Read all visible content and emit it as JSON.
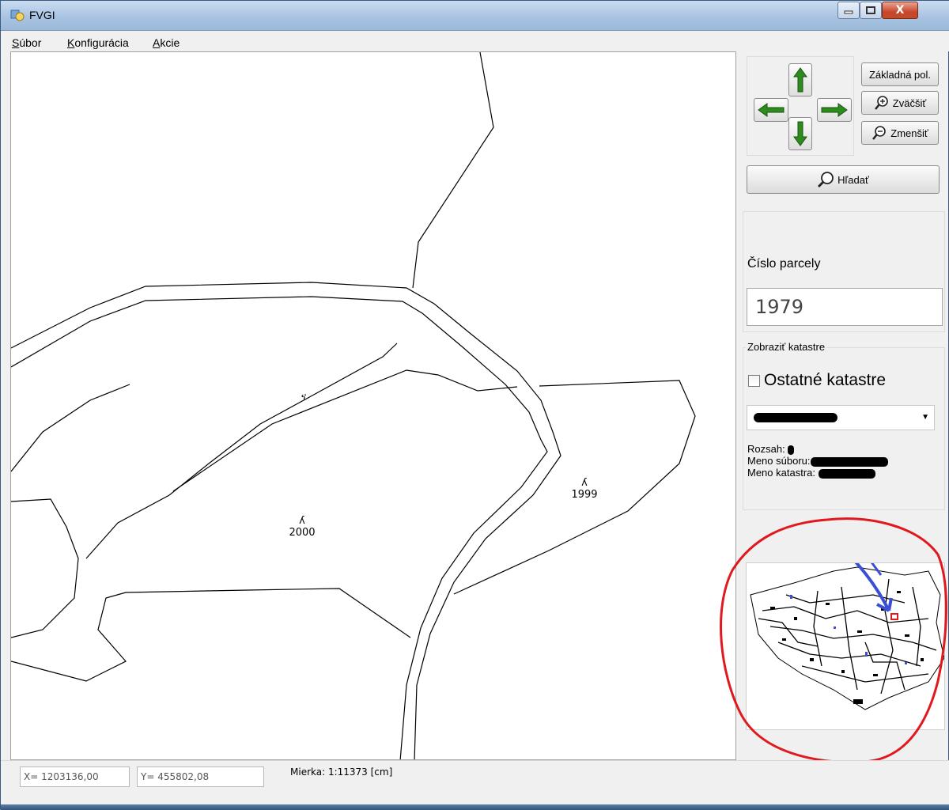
{
  "window": {
    "title": "FVGI",
    "minimize_icon": "minimize-icon",
    "maximize_icon": "maximize-icon",
    "close_label": "X"
  },
  "menu": {
    "subor": {
      "hot": "S",
      "rest": "úbor"
    },
    "konfiguracia": {
      "hot": "K",
      "rest": "onfigurácia"
    },
    "akcie": {
      "hot": "A",
      "rest": "kcie"
    }
  },
  "map": {
    "parcels": [
      {
        "symbol": "ʎ",
        "number": "2000"
      },
      {
        "symbol": "ʎ",
        "number": "1999"
      }
    ],
    "road_mark": "ና"
  },
  "navigation": {
    "up_icon": "arrow-up-icon",
    "down_icon": "arrow-down-icon",
    "left_icon": "arrow-left-icon",
    "right_icon": "arrow-right-icon",
    "color_arrow": "#2e8b1e"
  },
  "buttons": {
    "zakladna": "Základná pol.",
    "zvacsit": "Zväčšiť",
    "zmensit": "Zmenšiť",
    "hladat": "Hľadať"
  },
  "parcel_search": {
    "label": "Číslo parcely",
    "value": "1979"
  },
  "katastre": {
    "group_title": "Zobraziť katastre",
    "checkbox_label": "Ostatné katastre",
    "checkbox_checked": false,
    "rozsah_label": "Rozsah:",
    "meno_suboru_label": "Meno súboru:",
    "meno_katastra_label": "Meno katastra:"
  },
  "status": {
    "x": "X= 1203136,00",
    "y": "Y= 455802,08",
    "mierka": "Mierka: 1:11373  [cm]"
  },
  "annotation": {
    "circle_color": "#e0191e",
    "arrow_color": "#3a4fd6"
  }
}
